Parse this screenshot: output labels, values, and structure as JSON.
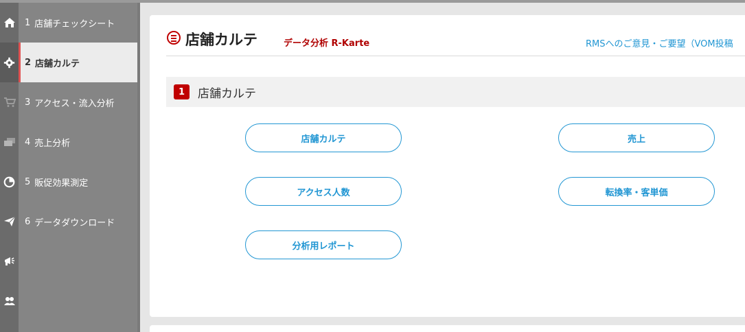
{
  "sidebar": {
    "items": [
      {
        "num": "1",
        "label": "店舗チェックシート",
        "icon": "home-icon"
      },
      {
        "num": "2",
        "label": "店舗カルテ",
        "icon": "gear-icon",
        "active": true
      },
      {
        "num": "3",
        "label": "アクセス・流入分析",
        "icon": "cart-icon"
      },
      {
        "num": "4",
        "label": "売上分析",
        "icon": "money-icon"
      },
      {
        "num": "5",
        "label": "販促効果測定",
        "icon": "pie-chart-icon"
      },
      {
        "num": "6",
        "label": "データダウンロード",
        "icon": "paper-plane-icon"
      }
    ],
    "extra_icons": [
      "megaphone-icon",
      "users-icon"
    ]
  },
  "header": {
    "title": "店舗カルテ",
    "subtitle": "データ分析 R-Karte",
    "feedback_link": "RMSへのご意見・ご要望（VOM投稿"
  },
  "section": {
    "number": "1",
    "title": "店舗カルテ"
  },
  "buttons": {
    "karte": "店舗カルテ",
    "sales": "売上",
    "access": "アクセス人数",
    "conversion": "転換率・客単価",
    "report": "分析用レポート"
  },
  "colors": {
    "accent_red": "#c00000",
    "link_blue": "#2196d3",
    "sidebar_gray": "#858585",
    "rail_gray": "#6b6b6b"
  }
}
